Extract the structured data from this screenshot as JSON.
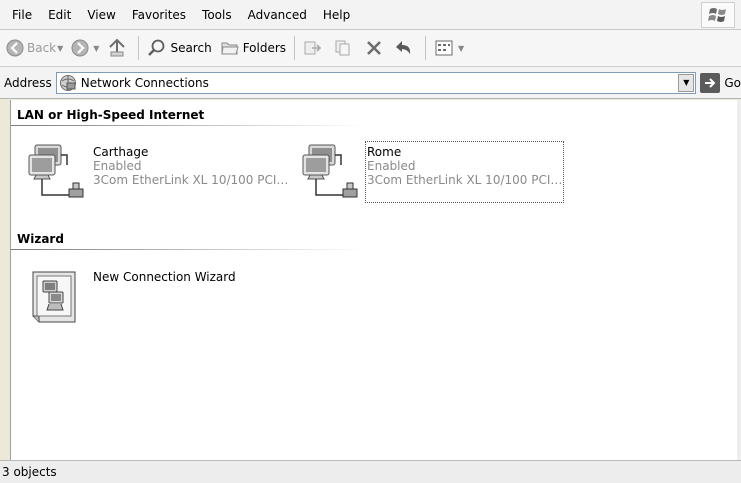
{
  "menu": {
    "items": [
      {
        "label": "File"
      },
      {
        "label": "Edit"
      },
      {
        "label": "View"
      },
      {
        "label": "Favorites"
      },
      {
        "label": "Tools"
      },
      {
        "label": "Advanced"
      },
      {
        "label": "Help"
      }
    ]
  },
  "toolbar": {
    "back_label": "Back",
    "search_label": "Search",
    "folders_label": "Folders"
  },
  "address": {
    "label": "Address",
    "value": "Network Connections",
    "go_label": "Go"
  },
  "groups": [
    {
      "title": "LAN or High-Speed Internet",
      "items": [
        {
          "name": "Carthage",
          "status": "Enabled",
          "device": "3Com EtherLink XL 10/100 PCI…",
          "selected": false
        },
        {
          "name": "Rome",
          "status": "Enabled",
          "device": "3Com EtherLink XL 10/100 PCI…",
          "selected": true
        }
      ]
    },
    {
      "title": "Wizard",
      "items": [
        {
          "name": "New Connection Wizard"
        }
      ]
    }
  ],
  "status": {
    "text": "3 objects"
  }
}
